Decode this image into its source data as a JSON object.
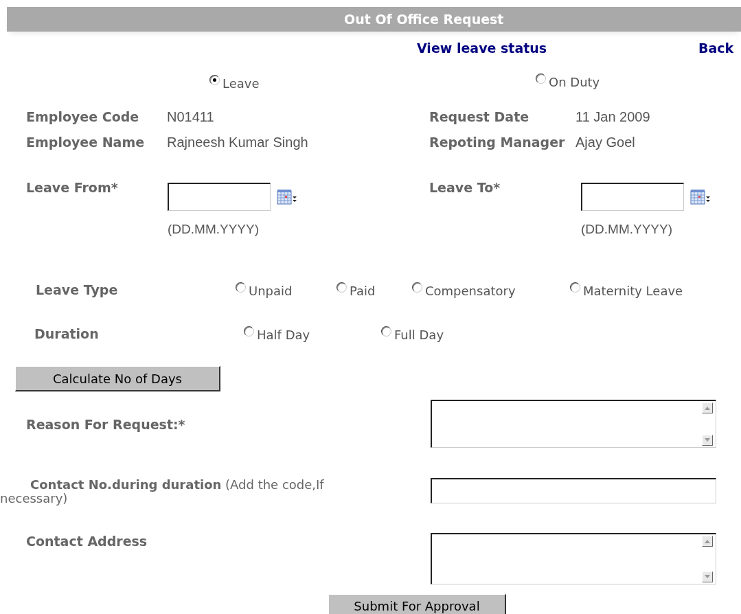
{
  "header": {
    "title": "Out Of Office Request"
  },
  "links": [
    {
      "label": "View leave status"
    },
    {
      "label": "Back"
    }
  ],
  "request_type": [
    {
      "label": "Leave",
      "selected": true
    },
    {
      "label": "On Duty",
      "selected": false
    }
  ],
  "employee_info": [
    {
      "label": "Employee Code",
      "value": "N01411"
    },
    {
      "label": "Request Date",
      "value": "11 Jan 2009"
    },
    {
      "label": "Employee Name",
      "value": "Rajneesh Kumar Singh"
    },
    {
      "label": "Repoting Manager",
      "value": "Ajay Goel"
    }
  ],
  "date_fields": [
    {
      "label": "Leave From*",
      "hint": "(DD.MM.YYYY)"
    },
    {
      "label": "Leave To*",
      "hint": "(DD.MM.YYYY)"
    }
  ],
  "leave_type": {
    "label": "Leave Type",
    "options": [
      {
        "label": "Unpaid",
        "selected": false
      },
      {
        "label": "Paid",
        "selected": false
      },
      {
        "label": "Compensatory",
        "selected": false
      },
      {
        "label": "Maternity Leave",
        "selected": false
      }
    ]
  },
  "duration": {
    "label": "Duration",
    "options": [
      {
        "label": "Half Day",
        "selected": false
      },
      {
        "label": "Full Day",
        "selected": false
      }
    ]
  },
  "calculate_button": "Calculate No of Days",
  "text_fields": [
    {
      "kind": "textarea",
      "label": "Reason For Request:*"
    },
    {
      "kind": "input",
      "label": "**Contact No.during duration**  (Add the code,If necessary)"
    },
    {
      "kind": "textarea",
      "label": "Contact Address"
    }
  ],
  "submit_button": "Submit For Approval"
}
